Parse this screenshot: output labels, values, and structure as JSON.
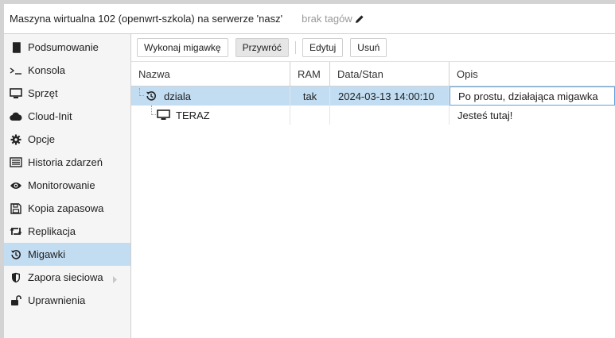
{
  "header": {
    "title": "Maszyna wirtualna 102 (openwrt-szkola) na serwerze 'nasz'",
    "tags_text": "brak tagów",
    "edit_icon": "pencil-icon"
  },
  "sidebar": {
    "items": [
      {
        "label": "Podsumowanie",
        "icon": "book-icon"
      },
      {
        "label": "Konsola",
        "icon": "terminal-icon"
      },
      {
        "label": "Sprzęt",
        "icon": "monitor-icon"
      },
      {
        "label": "Cloud-Init",
        "icon": "cloud-icon"
      },
      {
        "label": "Opcje",
        "icon": "gear-icon"
      },
      {
        "label": "Historia zdarzeń",
        "icon": "list-icon"
      },
      {
        "label": "Monitorowanie",
        "icon": "eye-icon"
      },
      {
        "label": "Kopia zapasowa",
        "icon": "floppy-icon"
      },
      {
        "label": "Replikacja",
        "icon": "retweet-icon"
      },
      {
        "label": "Migawki",
        "icon": "history-icon",
        "active": true
      },
      {
        "label": "Zapora sieciowa",
        "icon": "shield-icon"
      },
      {
        "label": "Uprawnienia",
        "icon": "unlock-icon"
      }
    ]
  },
  "toolbar": {
    "take_snapshot": "Wykonaj migawkę",
    "rollback": "Przywróć",
    "edit": "Edytuj",
    "remove": "Usuń"
  },
  "grid": {
    "columns": [
      "Nazwa",
      "RAM",
      "Data/Stan",
      "Opis"
    ],
    "rows": [
      {
        "name": "dziala",
        "ram": "tak",
        "date": "2024-03-13 14:00:10",
        "description": "Po prostu, działająca migawka",
        "icon": "history-icon",
        "selected": true
      },
      {
        "name": "TERAZ",
        "ram": "",
        "date": "",
        "description": "Jesteś tutaj!",
        "icon": "monitor-icon",
        "selected": false
      }
    ]
  },
  "colors": {
    "selection": "#c2ddf2",
    "focus_border": "#5fa2dd"
  }
}
